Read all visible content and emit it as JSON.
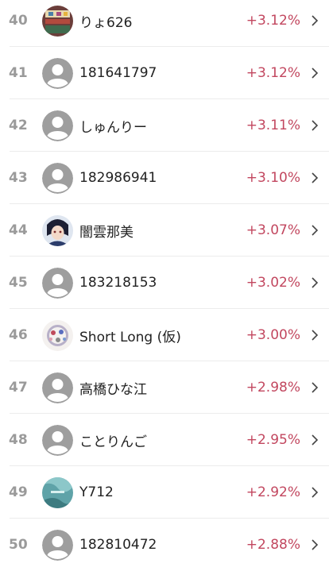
{
  "rows": [
    {
      "rank": "40",
      "name": "りょ626",
      "change": "+3.12%",
      "avatar": "photo-icon"
    },
    {
      "rank": "41",
      "name": "181641797",
      "change": "+3.12%",
      "avatar": "default-user-icon"
    },
    {
      "rank": "42",
      "name": "しゅんりー",
      "change": "+3.11%",
      "avatar": "default-user-icon"
    },
    {
      "rank": "43",
      "name": "182986941",
      "change": "+3.10%",
      "avatar": "default-user-icon"
    },
    {
      "rank": "44",
      "name": "闇雲那美",
      "change": "+3.07%",
      "avatar": "photo-icon"
    },
    {
      "rank": "45",
      "name": "183218153",
      "change": "+3.02%",
      "avatar": "default-user-icon"
    },
    {
      "rank": "46",
      "name": "Short Long (仮)",
      "change": "+3.00%",
      "avatar": "photo-icon"
    },
    {
      "rank": "47",
      "name": "高橋ひな江",
      "change": "+2.98%",
      "avatar": "default-user-icon"
    },
    {
      "rank": "48",
      "name": "ことりんご",
      "change": "+2.95%",
      "avatar": "default-user-icon"
    },
    {
      "rank": "49",
      "name": "Y712",
      "change": "+2.92%",
      "avatar": "photo-icon"
    },
    {
      "rank": "50",
      "name": "182810472",
      "change": "+2.88%",
      "avatar": "default-user-icon"
    }
  ],
  "colors": {
    "positive": "#c2475f",
    "rank": "#9a9a9a"
  }
}
